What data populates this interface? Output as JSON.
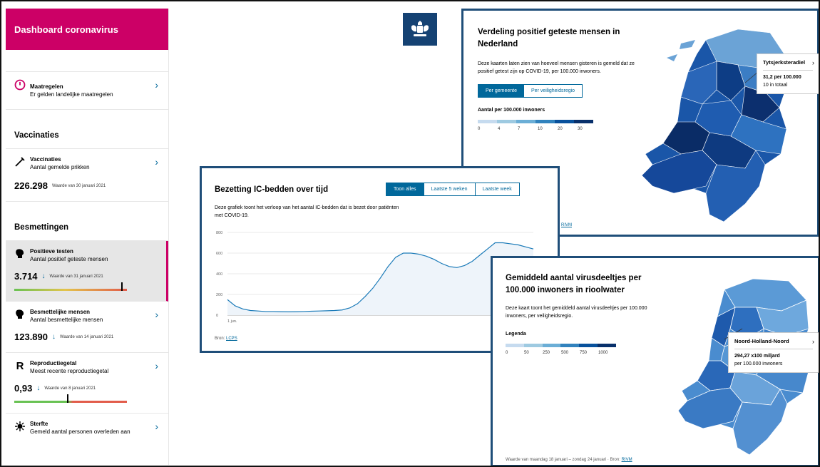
{
  "sidebar": {
    "header": "Dashboard coronavirus",
    "maatregelen": {
      "title": "Maatregelen",
      "sub": "Er gelden landelijke maatregelen"
    },
    "section_vaccinaties": "Vaccinaties",
    "vaccinaties": {
      "title": "Vaccinaties",
      "sub": "Aantal gemelde prikken",
      "value": "226.298",
      "date": "Waarde van 30 januari 2021"
    },
    "section_besmettingen": "Besmettingen",
    "positieve_testen": {
      "title": "Positieve testen",
      "sub": "Aantal positief geteste mensen",
      "value": "3.714",
      "date": "Waarde van 31 januari 2021"
    },
    "besmettelijke": {
      "title": "Besmettelijke mensen",
      "sub": "Aantal besmettelijke mensen",
      "value": "123.890",
      "date": "Waarde van 14 januari 2021"
    },
    "reproductie": {
      "title": "Reproductiegetal",
      "sub": "Meest recente reproductiegetal",
      "value": "0,93",
      "date": "Waarde van 8 januari 2021"
    },
    "sterfte": {
      "title": "Sterfte",
      "sub": "Gemeld aantal personen overleden aan"
    },
    "chevron": "›",
    "arrow": "↓",
    "r_icon": "R"
  },
  "map1": {
    "title": "Verdeling positief geteste mensen in Nederland",
    "desc": "Deze kaarten laten zien van hoeveel mensen gisteren is gemeld dat ze positief getest zijn op COVID-19, per 100.000 inwoners.",
    "tab_active": "Per gemeente",
    "tab_other": "Per veiligheidsregio",
    "legend_title": "Aantal per 100.000 inwoners",
    "legend_ticks": [
      "0",
      "4",
      "7",
      "10",
      "20",
      "30"
    ],
    "legend_colors": [
      "#c6dbef",
      "#9ecae1",
      "#6baed6",
      "#3182bd",
      "#08519c",
      "#08306b"
    ],
    "tooltip_title": "Tytsjerksteradiel",
    "tooltip_line1": "31,2 per 100.000",
    "tooltip_line2": "10 in totaal",
    "source": "RIVM"
  },
  "ic": {
    "title": "Bezetting IC-bedden over tijd",
    "tabs": [
      "Toon alles",
      "Laatste 5 weken",
      "Laatste week"
    ],
    "desc": "Deze grafiek toont het verloop van het aantal IC-bedden dat is bezet door patiënten met COVID-19.",
    "source_label": "Bron:",
    "source": "LCPS"
  },
  "map2": {
    "title": "Gemiddeld aantal virusdeeltjes per 100.000 inwoners in rioolwater",
    "desc": "Deze kaart toont het gemiddeld aantal virusdeeltjes per 100.000 inwoners, per veiligheidsregio.",
    "legend_title": "Legenda",
    "legend_ticks": [
      "0",
      "50",
      "250",
      "500",
      "750",
      "1000"
    ],
    "legend_colors": [
      "#c6dbef",
      "#9ecae1",
      "#6baed6",
      "#3182bd",
      "#08519c",
      "#08306b"
    ],
    "tooltip_title": "Noord-Holland-Noord",
    "tooltip_line1": "294,27 x100 miljard",
    "tooltip_line2": "per 100.000 inwoners",
    "footer": "Waarde van maandag 18 januari – zondag 24 januari · Bron:",
    "source": "RIVM"
  },
  "chart_data": {
    "type": "line",
    "title": "Bezetting IC-bedden over tijd",
    "xlabel": "",
    "ylabel": "",
    "ylim": [
      0,
      800
    ],
    "yticks": [
      0,
      200,
      400,
      600,
      800
    ],
    "xticks": [
      "1 jun."
    ],
    "x": [
      0,
      1,
      2,
      3,
      4,
      5,
      6,
      7,
      8,
      9,
      10,
      11,
      12,
      13,
      14,
      15,
      16,
      17,
      18,
      19,
      20,
      21,
      22,
      23,
      24,
      25,
      26,
      27,
      28,
      29,
      30,
      31,
      32,
      33,
      34,
      35,
      36,
      37,
      38,
      39,
      40
    ],
    "values": [
      150,
      90,
      60,
      45,
      40,
      35,
      35,
      33,
      32,
      33,
      35,
      38,
      40,
      42,
      45,
      50,
      70,
      110,
      180,
      260,
      360,
      470,
      560,
      600,
      600,
      590,
      570,
      540,
      500,
      470,
      460,
      480,
      520,
      580,
      640,
      700,
      700,
      690,
      680,
      660,
      640
    ],
    "grid": true
  }
}
